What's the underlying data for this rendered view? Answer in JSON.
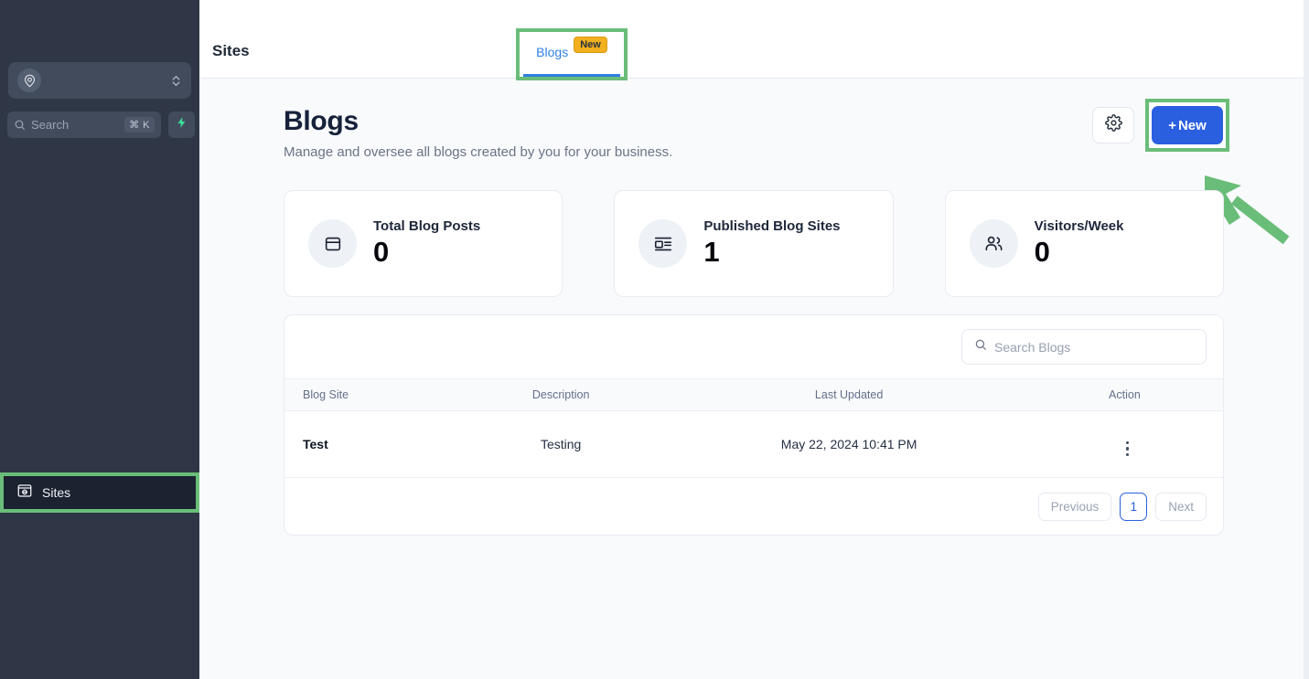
{
  "sidebar": {
    "workspace": {
      "name": "",
      "avatar_icon": "location-pin-avatar-icon",
      "chevron_icon": "chevron-up-down-icon"
    },
    "search": {
      "placeholder": "Search",
      "shortcut": "⌘ K",
      "icon": "search-icon"
    },
    "quick_action": {
      "icon": "lightning-bolt-icon"
    },
    "nav_items": [
      {
        "label": "Sites",
        "icon": "sites-window-globe-icon",
        "active": true,
        "highlighted": true
      }
    ]
  },
  "topbar": {
    "title": "Sites",
    "tabs": [
      {
        "label": "Blogs",
        "badge": "New",
        "active": true,
        "highlighted": true
      }
    ]
  },
  "page": {
    "title": "Blogs",
    "subtitle": "Manage and oversee all blogs created by you for your business.",
    "actions": {
      "settings": {
        "icon": "gear-icon",
        "label": ""
      },
      "new": {
        "label": "New",
        "plus": "+",
        "highlighted": true,
        "color": "#2a5fe0"
      }
    }
  },
  "stats": [
    {
      "label": "Total Blog Posts",
      "value": "0",
      "icon": "window-panel-icon"
    },
    {
      "label": "Published Blog Sites",
      "value": "1",
      "icon": "newspaper-icon"
    },
    {
      "label": "Visitors/Week",
      "value": "0",
      "icon": "users-icon"
    }
  ],
  "table": {
    "search": {
      "placeholder": "Search Blogs",
      "icon": "search-icon"
    },
    "columns": [
      "Blog Site",
      "Description",
      "Last Updated",
      "Action"
    ],
    "rows": [
      {
        "name": "Test",
        "description": "Testing",
        "last_updated": "May 22, 2024 10:41 PM",
        "action_icon": "kebab-menu-icon"
      }
    ],
    "pagination": {
      "previous": "Previous",
      "next": "Next",
      "pages": [
        "1"
      ],
      "current_page": "1"
    }
  },
  "annotations": {
    "highlight_color": "#6abd78",
    "arrow": {
      "points_to": "new-button",
      "color": "#6abd78"
    }
  }
}
